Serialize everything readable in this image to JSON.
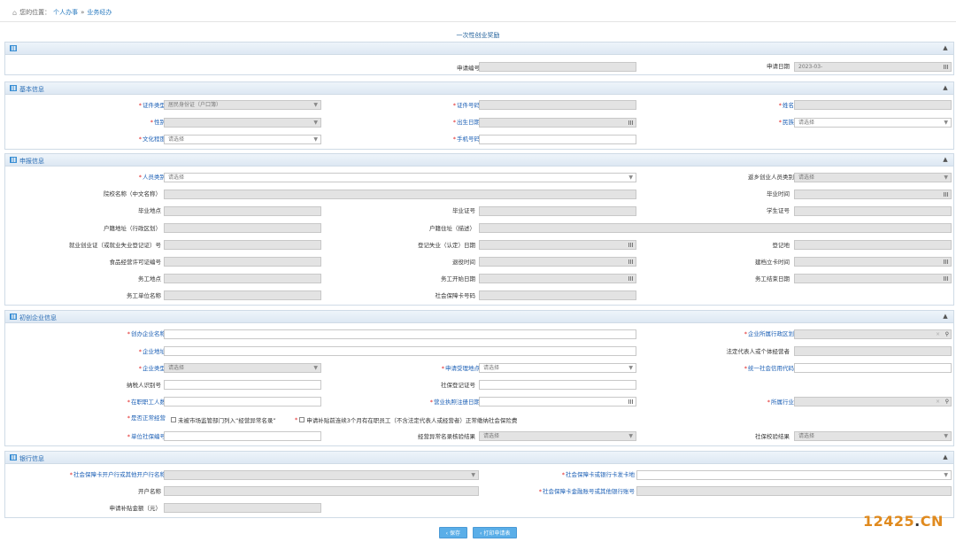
{
  "breadcrumb": {
    "prefix": "您的位置：",
    "item1": "个人办事",
    "sep": "»",
    "item2": "业务经办"
  },
  "page_title": "一次性创业奖励",
  "panel_top": {
    "title": "",
    "apply_no_label": "申请编号",
    "apply_no_value": "",
    "apply_date_label": "申请日期",
    "apply_date_value": "2023-03-"
  },
  "basic": {
    "title": "基本信息",
    "id_type_label": "证件类型",
    "id_type_value": "居民身份证（户口簿）",
    "id_no_label": "证件号码",
    "name_label": "姓名",
    "gender_label": "性别",
    "birth_label": "出生日期",
    "nation_label": "民族",
    "nation_placeholder": "请选择",
    "edu_label": "文化程度",
    "edu_placeholder": "请选择",
    "phone_label": "手机号码"
  },
  "declare": {
    "title": "申报信息",
    "person_type_label": "人员类别",
    "person_type_placeholder": "请选择",
    "return_type_label": "返乡创业人员类别",
    "return_type_placeholder": "请选择",
    "school_label": "院校名称（中文名称）",
    "grad_time_label": "毕业时间",
    "grad_place_label": "毕业地点",
    "grad_cert_label": "毕业证号",
    "degree_cert_label": "学生证号",
    "hukou_addr_label": "户籍地址（行政区划）",
    "hukou_detail_label": "户籍住址（描述）",
    "emp_cert_label": "就业创业证（或就业失业登记证）号",
    "reg_unemp_label": "登记失业（认定）日期",
    "reg_place_label": "登记地",
    "food_license_label": "食品经营许可证编号",
    "retire_time_label": "退役时间",
    "card_time_label": "建档立卡时间",
    "work_place_label": "务工地点",
    "work_start_label": "务工开始日期",
    "work_end_label": "务工结束日期",
    "work_unit_label": "务工单位名称",
    "ss_card_label": "社会保障卡号码"
  },
  "company": {
    "title": "初创企业信息",
    "name_label": "创办企业名称",
    "district_label": "企业所属行政区划",
    "addr_label": "企业地址",
    "legal_label": "法定代表人或个体经营者",
    "type_label": "企业类型",
    "type_placeholder": "请选择",
    "accept_label": "申请受理地点",
    "accept_placeholder": "请选择",
    "credit_label": "统一社会信用代码",
    "tax_label": "纳税人识别号",
    "ss_reg_label": "社保登记证号",
    "employees_label": "在职职工人数",
    "license_date_label": "营业执照注册日期",
    "industry_label": "所属行业",
    "normal_label": "是否正常经营",
    "normal_opt1": "未被市场监管部门列入“经营异常名录”",
    "normal_opt2": "申请补贴前连续3个月有在职员工（不含法定代表人或经营者）正常缴纳社会保险费",
    "unit_ss_label": "单位社保编号",
    "abnormal_check_label": "经营异常名录核验结果",
    "abnormal_check_placeholder": "请选择",
    "ss_check_label": "社保校验结果",
    "ss_check_placeholder": "请选择"
  },
  "bank": {
    "title": "银行信息",
    "bank_name_label": "社会保障卡开户行或其他开户行名称",
    "card_bank_label": "社会保障卡或银行卡发卡地",
    "holder_label": "开户名称",
    "account_label": "社会保障卡金融账号或其他银行账号",
    "amount_label": "申请补贴金额（元）"
  },
  "buttons": {
    "save": "保存",
    "print": "打印申请表"
  },
  "watermark": {
    "a": "12425",
    "dot": ".",
    "b": "CN"
  }
}
